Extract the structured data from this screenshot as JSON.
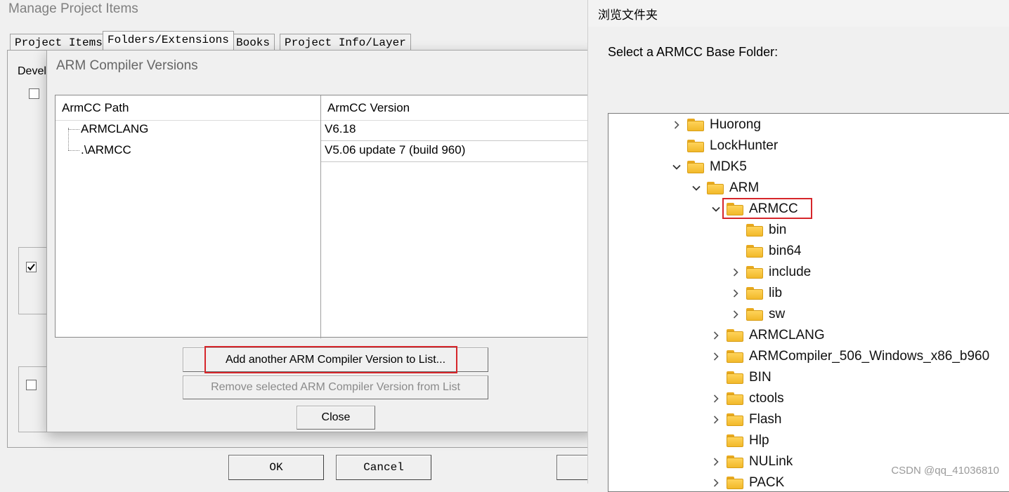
{
  "manage_window": {
    "title": "Manage Project Items",
    "tabs": [
      "Project Items",
      "Folders/Extensions",
      "Books",
      "Project Info/Layer"
    ],
    "devel_label": "Devel",
    "buttons": {
      "ok": "OK",
      "cancel": "Cancel"
    }
  },
  "arm_dialog": {
    "title": "ARM Compiler Versions",
    "columns": {
      "path": "ArmCC Path",
      "version": "ArmCC Version"
    },
    "rows": [
      {
        "path": "ARMCLANG",
        "version": "V6.18"
      },
      {
        "path": ".\\ARMCC",
        "version": "V5.06 update 7 (build 960)"
      }
    ],
    "buttons": {
      "add": "Add another ARM Compiler Version to List...",
      "remove": "Remove selected ARM Compiler Version from List",
      "close": "Close"
    }
  },
  "browse_dialog": {
    "title": "浏览文件夹",
    "prompt": "Select a ARMCC Base Folder:",
    "tree": [
      {
        "label": "Huorong",
        "level": 0,
        "chevron": "collapsed"
      },
      {
        "label": "LockHunter",
        "level": 0,
        "chevron": "none"
      },
      {
        "label": "MDK5",
        "level": 0,
        "chevron": "expanded"
      },
      {
        "label": "ARM",
        "level": 1,
        "chevron": "expanded"
      },
      {
        "label": "ARMCC",
        "level": 2,
        "chevron": "expanded",
        "highlighted": true
      },
      {
        "label": "bin",
        "level": 3,
        "chevron": "none"
      },
      {
        "label": "bin64",
        "level": 3,
        "chevron": "none"
      },
      {
        "label": "include",
        "level": 3,
        "chevron": "collapsed"
      },
      {
        "label": "lib",
        "level": 3,
        "chevron": "collapsed"
      },
      {
        "label": "sw",
        "level": 3,
        "chevron": "collapsed"
      },
      {
        "label": "ARMCLANG",
        "level": 2,
        "chevron": "collapsed"
      },
      {
        "label": "ARMCompiler_506_Windows_x86_b960",
        "level": 2,
        "chevron": "collapsed"
      },
      {
        "label": "BIN",
        "level": 2,
        "chevron": "none"
      },
      {
        "label": "ctools",
        "level": 2,
        "chevron": "collapsed"
      },
      {
        "label": "Flash",
        "level": 2,
        "chevron": "collapsed"
      },
      {
        "label": "Hlp",
        "level": 2,
        "chevron": "none"
      },
      {
        "label": "NULink",
        "level": 2,
        "chevron": "collapsed"
      },
      {
        "label": "PACK",
        "level": 2,
        "chevron": "collapsed"
      }
    ]
  },
  "watermark": "CSDN @qq_41036810",
  "colors": {
    "highlight_border": "#d6262b",
    "folder": "#f7c33f"
  }
}
